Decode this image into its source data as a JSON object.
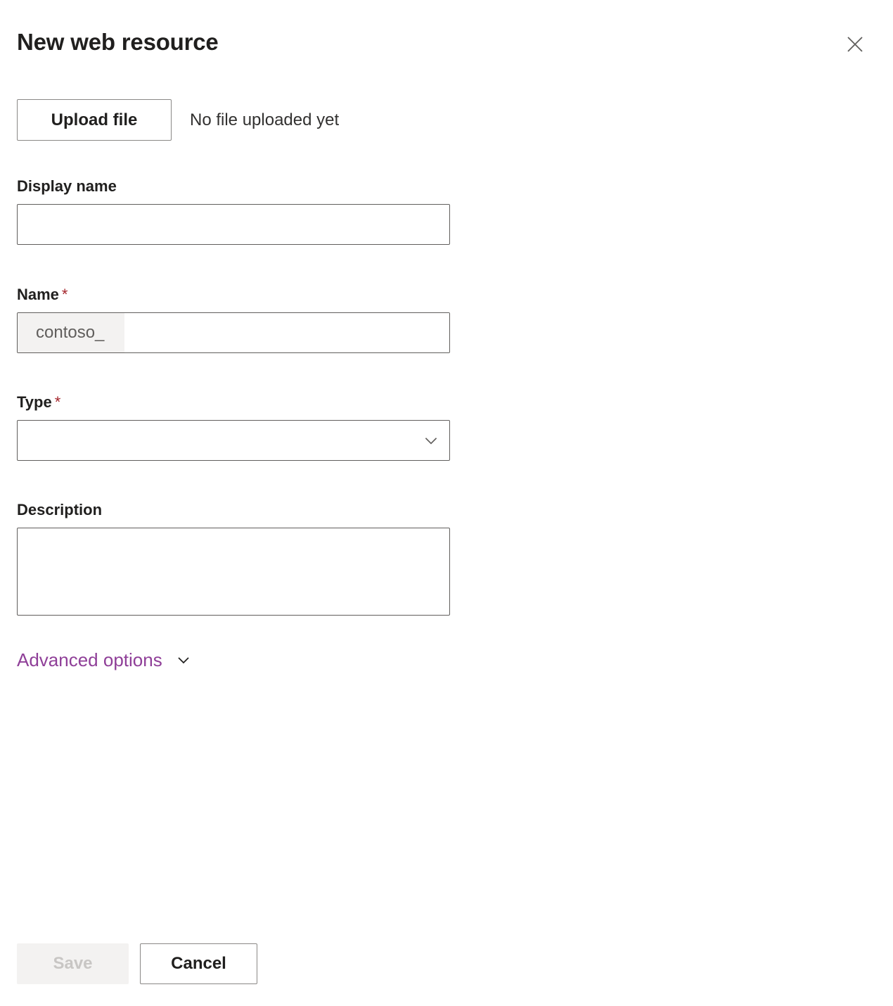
{
  "header": {
    "title": "New web resource",
    "close_icon": "close-icon"
  },
  "upload": {
    "button_label": "Upload file",
    "status_text": "No file uploaded yet"
  },
  "fields": {
    "display_name": {
      "label": "Display name",
      "value": "",
      "placeholder": ""
    },
    "name": {
      "label": "Name",
      "required_marker": "*",
      "prefix": "contoso_",
      "value": "",
      "placeholder": ""
    },
    "type": {
      "label": "Type",
      "required_marker": "*",
      "selected": "",
      "chevron_icon": "chevron-down-icon"
    },
    "description": {
      "label": "Description",
      "value": "",
      "placeholder": ""
    }
  },
  "advanced": {
    "label": "Advanced options",
    "chevron_icon": "chevron-down-icon"
  },
  "footer": {
    "save_label": "Save",
    "cancel_label": "Cancel"
  },
  "colors": {
    "accent_purple": "#8f3f98",
    "required_red": "#a4262c",
    "text_primary": "#201f1e",
    "text_secondary": "#605e5c",
    "border": "#605e5c",
    "disabled_bg": "#f3f2f1",
    "disabled_text": "#c8c6c4"
  }
}
